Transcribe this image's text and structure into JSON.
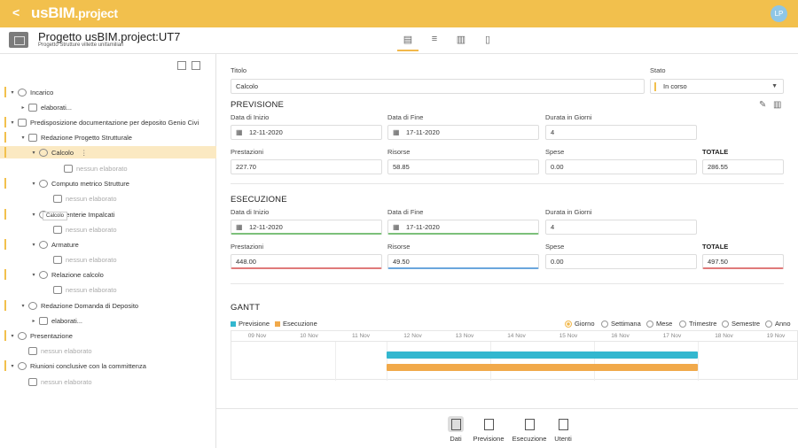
{
  "app": {
    "logo_main": "usBIM",
    "logo_suffix": ".project",
    "back": "<",
    "user_initials": "LP"
  },
  "header": {
    "title": "Progetto usBIM.project:UT7",
    "subtitle": "Progetto Strutture villette unifamiliari"
  },
  "tree": [
    {
      "label": "Incarico",
      "muted": false
    },
    {
      "label": "elaborati...",
      "muted": false
    },
    {
      "label": "Predisposizione documentazione per deposito Genio Civi",
      "muted": false
    },
    {
      "label": "Redazione Progetto Strutturale",
      "muted": false
    },
    {
      "label": "Calcolo",
      "muted": false
    },
    {
      "label": "nessun elaborato",
      "muted": true
    },
    {
      "label": "Computo metrico Strutture",
      "muted": false
    },
    {
      "label": "nessun elaborato",
      "muted": true
    },
    {
      "label": "Carpenterie Impalcati",
      "muted": false
    },
    {
      "label": "nessun elaborato",
      "muted": true
    },
    {
      "label": "Armature",
      "muted": false
    },
    {
      "label": "nessun elaborato",
      "muted": true
    },
    {
      "label": "Relazione calcolo",
      "muted": false
    },
    {
      "label": "nessun elaborato",
      "muted": true
    },
    {
      "label": "Redazione Domanda di Deposito",
      "muted": false
    },
    {
      "label": "elaborati...",
      "muted": false
    },
    {
      "label": "Presentazione",
      "muted": false
    },
    {
      "label": "nessun elaborato",
      "muted": true
    },
    {
      "label": "Riunioni conclusive con la committenza",
      "muted": false
    },
    {
      "label": "nessun elaborato",
      "muted": true
    }
  ],
  "tooltip": "Calcolo",
  "form": {
    "titolo_label": "Titolo",
    "titolo_value": "Calcolo",
    "stato_label": "Stato",
    "stato_value": "In corso",
    "previsione": {
      "title": "PREVISIONE",
      "data_inizio_label": "Data di Inizio",
      "data_inizio": "12-11-2020",
      "data_fine_label": "Data di Fine",
      "data_fine": "17-11-2020",
      "durata_label": "Durata in Giorni",
      "durata": "4",
      "prestazioni_label": "Prestazioni",
      "prestazioni": "227.70",
      "risorse_label": "Risorse",
      "risorse": "58.85",
      "spese_label": "Spese",
      "spese": "0.00",
      "totale_label": "TOTALE",
      "totale": "286.55"
    },
    "esecuzione": {
      "title": "ESECUZIONE",
      "data_inizio_label": "Data di Inizio",
      "data_inizio": "12-11-2020",
      "data_fine_label": "Data di Fine",
      "data_fine": "17-11-2020",
      "durata_label": "Durata in Giorni",
      "durata": "4",
      "prestazioni_label": "Prestazioni",
      "prestazioni": "448.00",
      "risorse_label": "Risorse",
      "risorse": "49.50",
      "spese_label": "Spese",
      "spese": "0.00",
      "totale_label": "TOTALE",
      "totale": "497.50"
    }
  },
  "gantt": {
    "title": "GANTT",
    "legend": [
      "Previsione",
      "Esecuzione"
    ],
    "colors": {
      "previsione": "#33b7cf",
      "esecuzione": "#f1a94a"
    },
    "scales": [
      "Giorno",
      "Settimana",
      "Mese",
      "Trimestre",
      "Semestre",
      "Anno"
    ],
    "selected_scale": "Giorno",
    "dates": [
      "09 Nov",
      "10 Nov",
      "11 Nov",
      "12 Nov",
      "13 Nov",
      "14 Nov",
      "15 Nov",
      "16 Nov",
      "17 Nov",
      "18 Nov",
      "19 Nov"
    ]
  },
  "bottom_tabs": [
    "Dati",
    "Previsione",
    "Esecuzione",
    "Utenti"
  ],
  "active_tab": "Dati"
}
